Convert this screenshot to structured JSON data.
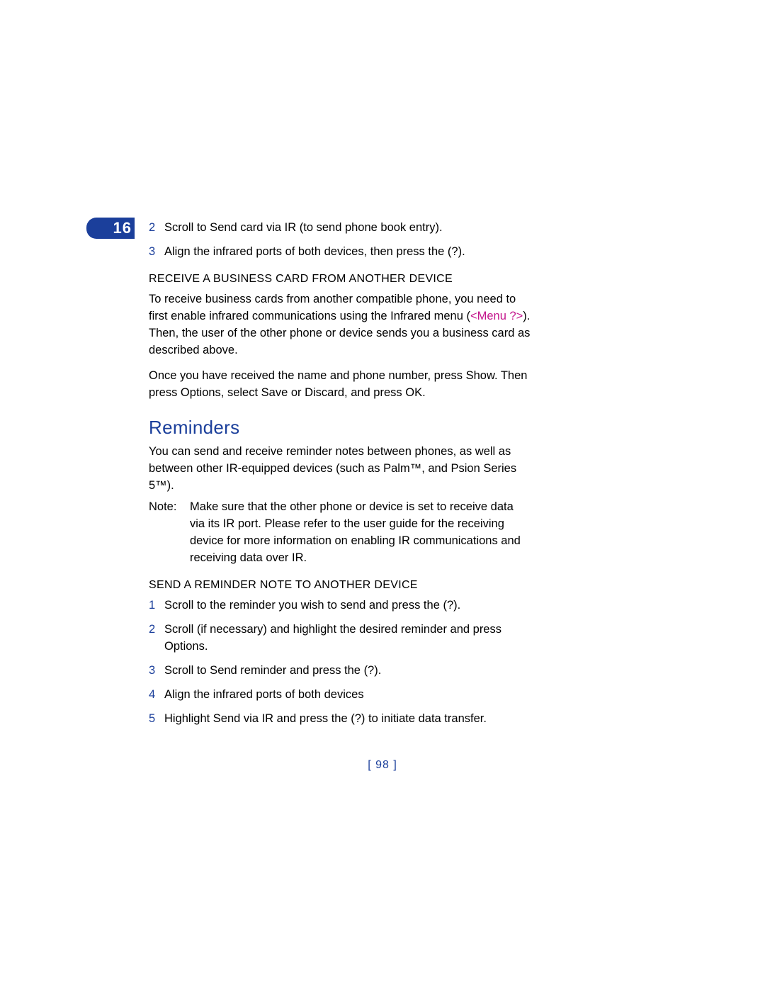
{
  "chapter_number": "16",
  "list_a": [
    {
      "n": "2",
      "t": "Scroll to Send card via IR (to send phone book entry)."
    },
    {
      "n": "3",
      "t": "Align the infrared ports of both devices, then press the (?)."
    }
  ],
  "subhead_1": "RECEIVE A BUSINESS CARD FROM ANOTHER DEVICE",
  "para_1a": "To receive business cards from another compatible phone, you need to first enable infrared communications using the Infrared menu (",
  "para_1_ref": "<Menu ?>",
  "para_1b": "). Then, the user of the other phone or device sends you a business card as described above.",
  "para_2": "Once you have received the name and phone number, press Show. Then press Options, select Save or Discard, and press OK.",
  "section_title": "Reminders",
  "para_3": "You can send and receive reminder notes between phones, as well as between other IR-equipped devices (such as Palm™, and Psion Series 5™).",
  "note_label": "Note:",
  "note_body": "Make sure that the other phone or device is set to receive data via its IR port. Please refer to the user guide for the receiving device for more information on enabling IR communications and receiving data over IR.",
  "subhead_2": "SEND A REMINDER NOTE TO ANOTHER DEVICE",
  "list_b": [
    {
      "n": "1",
      "t": "Scroll to the reminder you wish to send and press the (?)."
    },
    {
      "n": "2",
      "t": "Scroll (if necessary) and highlight the desired reminder and press Options."
    },
    {
      "n": "3",
      "t": "Scroll to Send reminder and press the (?)."
    },
    {
      "n": "4",
      "t": "Align the infrared ports of both devices"
    },
    {
      "n": "5",
      "t": "Highlight Send via IR and press the (?) to initiate data transfer."
    }
  ],
  "page_number": "[ 98 ]"
}
